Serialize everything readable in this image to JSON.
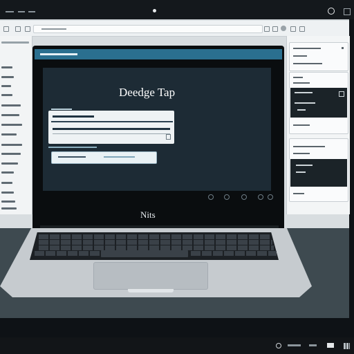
{
  "laptop_screen": {
    "heading": "Deedge Tap",
    "footer_label": "Nits"
  },
  "colors": {
    "accent": "#2a6f8f",
    "screen_background": "#1d2b35",
    "desk": "#3e4a50",
    "chrome_dark": "#14181c"
  },
  "icons": {
    "top_right": [
      "circle-icon",
      "square-icon"
    ],
    "laptop_controls": [
      "dot-icon",
      "dot-icon",
      "dot-icon",
      "dot-icon",
      "dot-icon"
    ],
    "taskbar": [
      "circle-icon",
      "window-icon",
      "grid-icon"
    ]
  }
}
